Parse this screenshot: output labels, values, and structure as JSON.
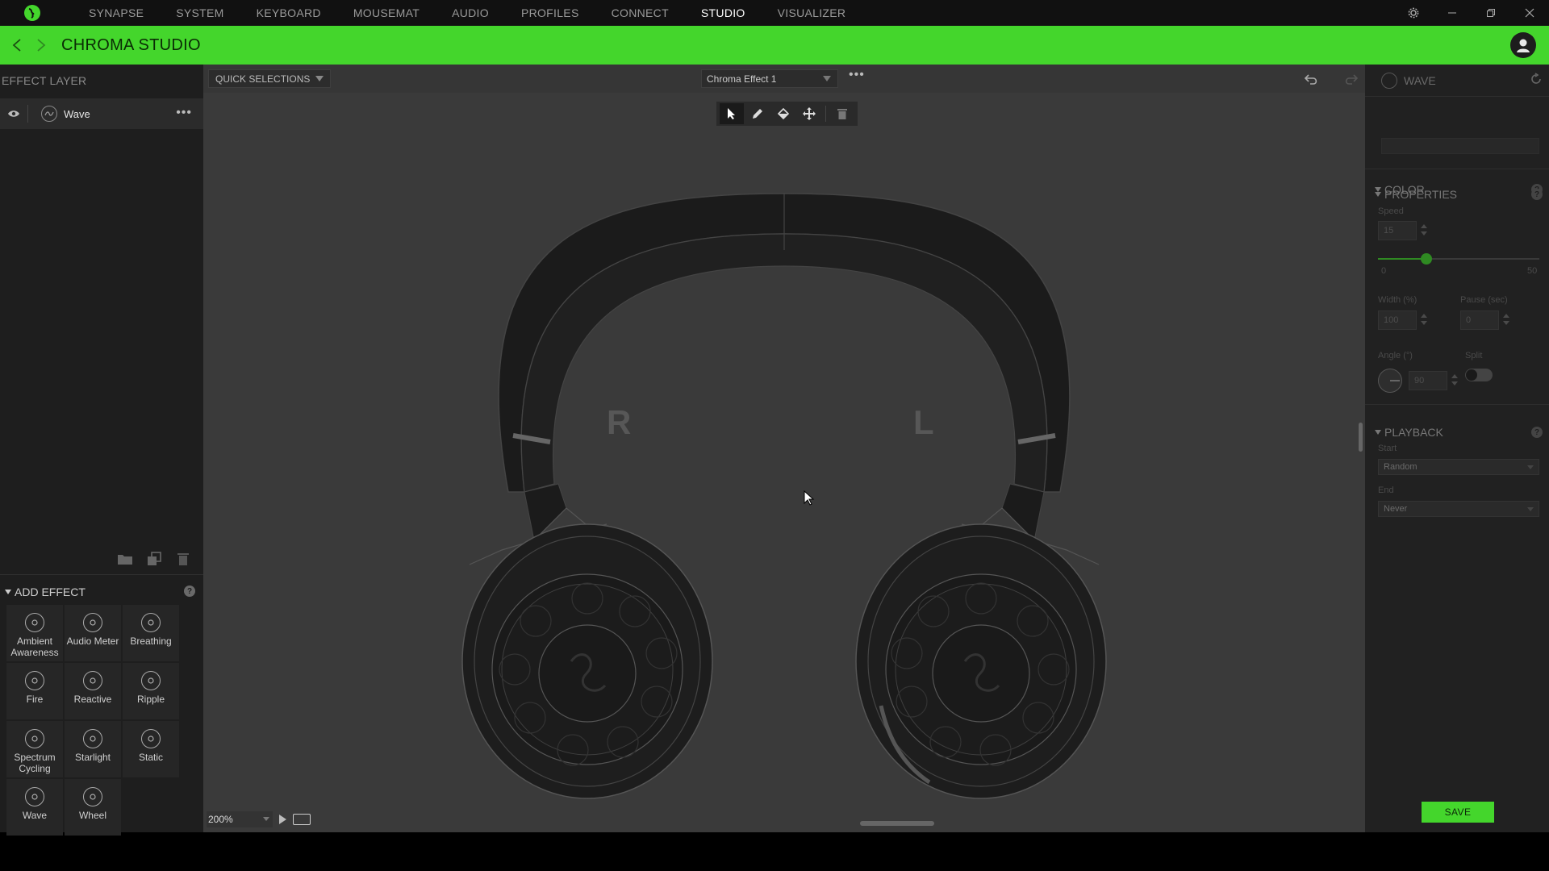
{
  "topnav": {
    "tabs": [
      {
        "label": "SYNAPSE"
      },
      {
        "label": "SYSTEM"
      },
      {
        "label": "KEYBOARD"
      },
      {
        "label": "MOUSEMAT"
      },
      {
        "label": "AUDIO"
      },
      {
        "label": "PROFILES"
      },
      {
        "label": "CONNECT"
      },
      {
        "label": "STUDIO",
        "active": true
      },
      {
        "label": "VISUALIZER"
      }
    ]
  },
  "header": {
    "title": "CHROMA STUDIO"
  },
  "left": {
    "heading": "EFFECT LAYER",
    "layers": [
      {
        "name": "Wave"
      }
    ],
    "add_effect": {
      "title": "ADD EFFECT",
      "effects": [
        {
          "label": "Ambient Awareness",
          "icon": "ambient-awareness-icon"
        },
        {
          "label": "Audio Meter",
          "icon": "audio-meter-icon"
        },
        {
          "label": "Breathing",
          "icon": "breathing-icon"
        },
        {
          "label": "Fire",
          "icon": "fire-icon"
        },
        {
          "label": "Reactive",
          "icon": "reactive-icon"
        },
        {
          "label": "Ripple",
          "icon": "ripple-icon"
        },
        {
          "label": "Spectrum Cycling",
          "icon": "spectrum-cycling-icon"
        },
        {
          "label": "Starlight",
          "icon": "starlight-icon"
        },
        {
          "label": "Static",
          "icon": "static-icon"
        },
        {
          "label": "Wave",
          "icon": "wave-icon"
        },
        {
          "label": "Wheel",
          "icon": "wheel-icon"
        }
      ]
    }
  },
  "canvas": {
    "quick_selections": "QUICK SELECTIONS",
    "effect_name": "Chroma Effect 1",
    "right_label": "R",
    "left_label": "L",
    "zoom": "200%"
  },
  "right": {
    "effect_title": "WAVE",
    "color": {
      "title": "COLOR"
    },
    "properties": {
      "title": "PROPERTIES",
      "speed_label": "Speed",
      "speed_value": "15",
      "speed_min": "0",
      "speed_max": "50",
      "speed_fraction": 0.3,
      "width_label": "Width (%)",
      "width_value": "100",
      "pause_label": "Pause (sec)",
      "pause_value": "0",
      "angle_label": "Angle (°)",
      "angle_value": "90",
      "split_label": "Split"
    },
    "playback": {
      "title": "PLAYBACK",
      "start_label": "Start",
      "start_value": "Random",
      "end_label": "End",
      "end_value": "Never"
    },
    "save_label": "SAVE"
  },
  "colors": {
    "accent": "#44d62c",
    "canvas": "#3a3a3a",
    "panel": "#1e1e1e"
  }
}
